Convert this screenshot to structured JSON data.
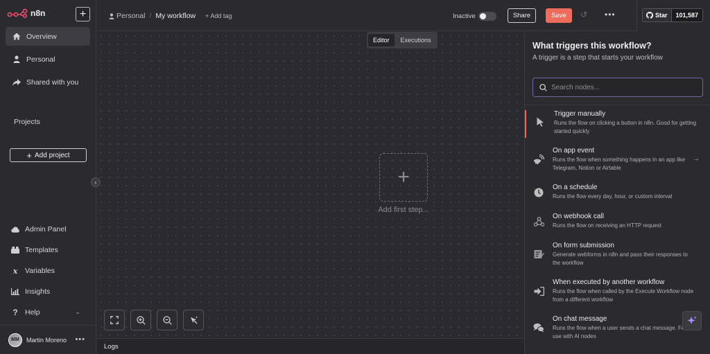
{
  "app": {
    "logo_text": "n8n"
  },
  "sidebar": {
    "items": [
      {
        "label": "Overview",
        "icon": "home-icon"
      },
      {
        "label": "Personal",
        "icon": "user-icon"
      },
      {
        "label": "Shared with you",
        "icon": "share-icon"
      }
    ],
    "projects_label": "Projects",
    "add_project_label": "Add project",
    "bottom_items": [
      {
        "label": "Admin Panel",
        "icon": "cloud-icon"
      },
      {
        "label": "Templates",
        "icon": "templates-icon"
      },
      {
        "label": "Variables",
        "icon": "variables-icon"
      },
      {
        "label": "Insights",
        "icon": "insights-icon"
      },
      {
        "label": "Help",
        "icon": "help-icon"
      }
    ],
    "user": {
      "initials": "MM",
      "name": "Martin Moreno"
    }
  },
  "header": {
    "breadcrumb_personal": "Personal",
    "breadcrumb_sep": "/",
    "workflow_name": "My workflow",
    "add_tag": "+ Add tag",
    "status_label": "Inactive",
    "share_label": "Share",
    "save_label": "Save",
    "github_star_label": "Star",
    "github_star_count": "101,587"
  },
  "canvas": {
    "tabs": [
      {
        "label": "Editor",
        "active": true
      },
      {
        "label": "Executions",
        "active": false
      }
    ],
    "add_first_step_label": "Add first step..."
  },
  "logs": {
    "label": "Logs"
  },
  "panel": {
    "title": "What triggers this workflow?",
    "subtitle": "A trigger is a step that starts your workflow",
    "search_placeholder": "Search nodes...",
    "triggers": [
      {
        "title": "Trigger manually",
        "desc": "Runs the flow on clicking a button in n8n. Good for getting started quickly",
        "icon": "cursor-icon"
      },
      {
        "title": "On app event",
        "desc": "Runs the flow when something happens in an app like Telegram, Notion or Airtable",
        "icon": "satellite-icon"
      },
      {
        "title": "On a schedule",
        "desc": "Runs the flow every day, hour, or custom interval",
        "icon": "clock-icon"
      },
      {
        "title": "On webhook call",
        "desc": "Runs the flow on receiving an HTTP request",
        "icon": "webhook-icon"
      },
      {
        "title": "On form submission",
        "desc": "Generate webforms in n8n and pass their responses to the workflow",
        "icon": "form-icon"
      },
      {
        "title": "When executed by another workflow",
        "desc": "Runs the flow when called by the Execute Workflow node from a different workflow",
        "icon": "sign-in-icon"
      },
      {
        "title": "On chat message",
        "desc": "Runs the flow when a user sends a chat message. For use with AI nodes",
        "icon": "chat-icon"
      }
    ]
  },
  "colors": {
    "accent": "#ee6c5b",
    "background": "#2a2a30",
    "panel": "#2b2b2f"
  }
}
